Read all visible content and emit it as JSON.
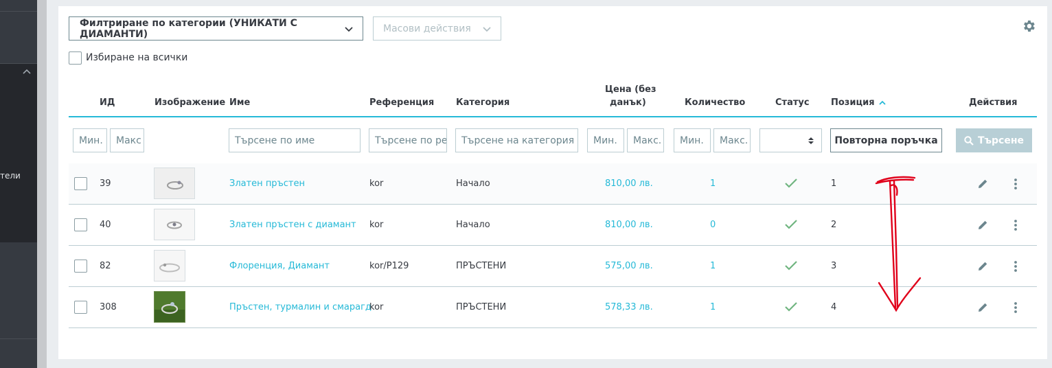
{
  "sidebar": {
    "partial_label": "тели"
  },
  "toolbar": {
    "category_filter_label": "Филтриране по категории (УНИКАТИ С ДИАМАНТИ)",
    "bulk_actions_label": "Масови действия",
    "select_all_label": "Избиране на всички"
  },
  "table": {
    "headers": {
      "id": "ИД",
      "image": "Изображение",
      "name": "Име",
      "reference": "Референция",
      "category": "Категория",
      "price_line1": "Цена (без",
      "price_line2": "данък)",
      "quantity": "Количество",
      "status": "Статус",
      "position": "Позиция",
      "actions": "Действия"
    },
    "filters": {
      "id_min": "Мин.",
      "id_max": "Макс",
      "name_placeholder": "Търсене по име",
      "reference_placeholder": "Търсене по ре",
      "category_placeholder": "Търсене на категория",
      "price_min": "Мин.",
      "price_max": "Макс.",
      "qty_min": "Мин.",
      "qty_max": "Макс.",
      "reorder_button": "Повторна поръчка",
      "search_button": "Търсене"
    },
    "rows": [
      {
        "id": "39",
        "name": "Златен пръстен",
        "reference": "kor",
        "category": "Начало",
        "price": "810,00 лв.",
        "quantity": "1",
        "position": "1"
      },
      {
        "id": "40",
        "name": "Златен пръстен с диамант",
        "reference": "kor",
        "category": "Начало",
        "price": "810,00 лв.",
        "quantity": "0",
        "position": "2"
      },
      {
        "id": "82",
        "name": "Флоренция, Диамант",
        "reference": "kor/P129",
        "category": "ПРЪСТЕНИ",
        "price": "575,00 лв.",
        "quantity": "1",
        "position": "3"
      },
      {
        "id": "308",
        "name": "Пръстен, турмалин и смарагд",
        "reference": "kor",
        "category": "ПРЪСТЕНИ",
        "price": "578,33 лв.",
        "quantity": "1",
        "position": "4"
      }
    ]
  },
  "colors": {
    "accent": "#25b9d7",
    "status_ok": "#70b580",
    "annotation": "#e0001a"
  },
  "icons": [
    "chevron-down-icon",
    "gear-icon",
    "sort-ascending-icon",
    "search-icon",
    "checkmark-icon",
    "pencil-icon",
    "kebab-menu-icon"
  ]
}
